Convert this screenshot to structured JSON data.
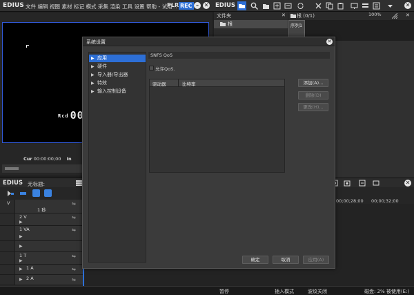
{
  "app": {
    "name": "EDIUS"
  },
  "menu": {
    "items": [
      "文件",
      "编辑",
      "视图",
      "素材",
      "标记",
      "模式",
      "采集",
      "渲染",
      "工具",
      "设置",
      "帮助"
    ],
    "trail": "- 试用..."
  },
  "player": {
    "mode_plr": "PLR",
    "mode_rec": "REC",
    "timecode_prefix": "Rcd",
    "timecode": "00:0",
    "cur_label": "Cur",
    "cur_time": "00:00:00;00",
    "in_label": "In"
  },
  "timeline": {
    "app_name": "EDIUS",
    "project": "无标题:",
    "ruler_labels": [
      "00;00;28;00",
      "00;00;32;00"
    ],
    "tracks": [
      {
        "label": "V",
        "extra": "1 秒"
      },
      {
        "label": "2 V"
      },
      {
        "label": "1 VA"
      },
      {
        "label": ""
      },
      {
        "label": "1 T"
      },
      {
        "label": "1 A"
      },
      {
        "label": "2 A"
      }
    ]
  },
  "bin": {
    "folder_header": "文件夹",
    "root_label": "根",
    "bin_title": "根 (0/1)",
    "zoom": "100%",
    "sequence_item": "序列1"
  },
  "status": {
    "hint": "暂停",
    "mode": "插入模式",
    "effect": "波纹关闭",
    "disk": "磁盘: 2% 被使用(E:)"
  },
  "dialog": {
    "title": "系统设置",
    "tree": [
      {
        "label": "应用",
        "selected": true
      },
      {
        "label": "硬件"
      },
      {
        "label": "导入器/导出器"
      },
      {
        "label": "特效"
      },
      {
        "label": "输入控制设备"
      }
    ],
    "section_title": "SNFS QoS",
    "checkbox_label": "允许QoS.",
    "table_headers": [
      "驱动器",
      "比特率"
    ],
    "buttons": {
      "add": "添加(A)...",
      "delete": "删除(D)",
      "change": "更改(H)...",
      "ok": "确定",
      "cancel": "取消",
      "apply": "应用(A)"
    }
  }
}
